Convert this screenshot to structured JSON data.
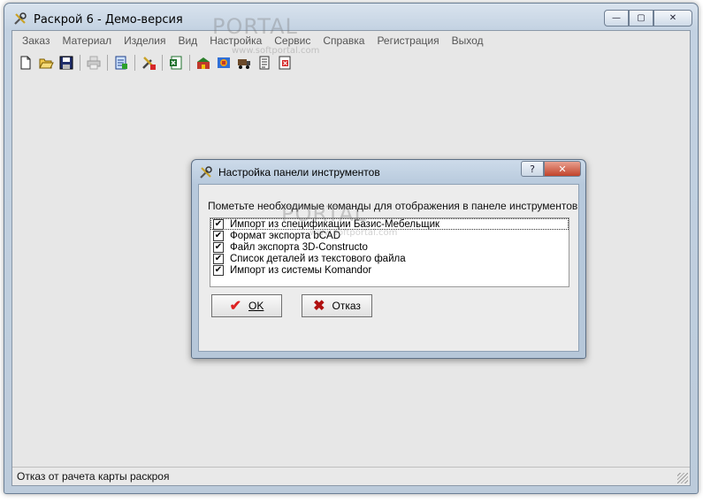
{
  "window": {
    "title": "Раскрой 6 - Демо-версия",
    "minimize": "—",
    "maximize": "▢",
    "close": "✕"
  },
  "menu": [
    "Заказ",
    "Материал",
    "Изделия",
    "Вид",
    "Настройка",
    "Сервис",
    "Справка",
    "Регистрация",
    "Выход"
  ],
  "toolbar": {
    "icons": [
      "new-file-icon",
      "open-folder-icon",
      "save-icon",
      "print-icon",
      "import-spec-icon",
      "settings-tools-icon",
      "excel-export-icon",
      "warehouse-icon",
      "export-3d-icon",
      "truck-icon",
      "text-list-icon",
      "komandor-import-icon"
    ]
  },
  "status": {
    "text": "Отказ от рачета карты раскроя"
  },
  "watermark": {
    "brand": "PORTAL",
    "url": "www.softportal.com"
  },
  "dialog": {
    "title": "Настройка панели инструментов",
    "help": "?",
    "close": "✕",
    "prompt": "Пометьте необходимые команды для отображения в панеле инструментов",
    "items": [
      {
        "label": "Импорт из спецификации Базис-Мебельщик",
        "checked": true
      },
      {
        "label": "Формат экспорта bCAD",
        "checked": true
      },
      {
        "label": "Файл экспорта 3D-Constructo",
        "checked": true
      },
      {
        "label": "Список деталей из текстового файла",
        "checked": true
      },
      {
        "label": "Импорт из системы Komandor",
        "checked": true
      }
    ],
    "ok_label": "OK",
    "cancel_label": "Отказ",
    "check_mark": "✔"
  }
}
